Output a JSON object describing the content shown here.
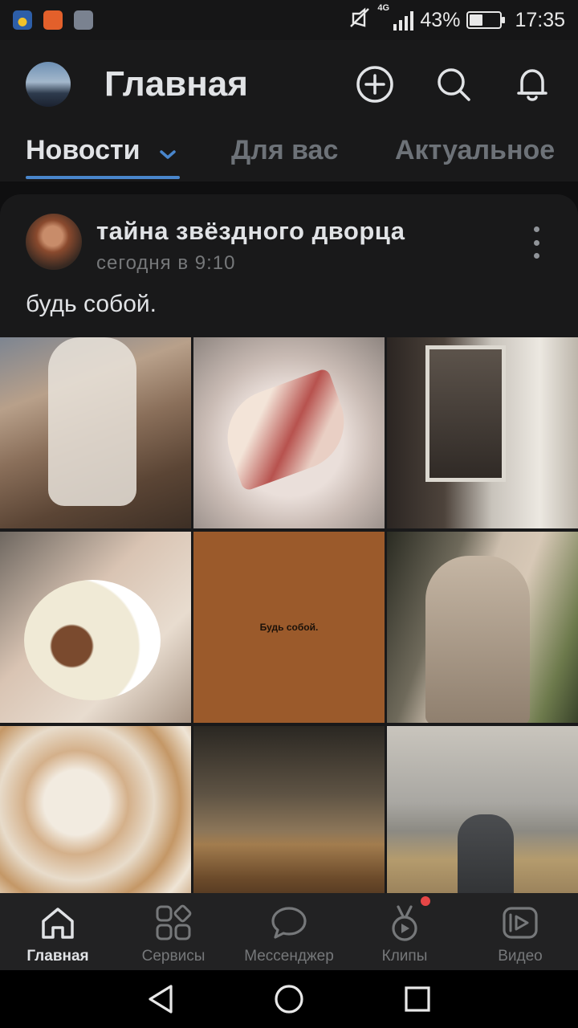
{
  "status_bar": {
    "network": "4G",
    "battery_text": "43%",
    "battery_level": 0.43,
    "time": "17:35",
    "app_icon_colors": [
      "#2d5ea8",
      "#e3602b",
      "#7a8290"
    ]
  },
  "header": {
    "title": "Главная",
    "icons": [
      "add-circle-icon",
      "search-icon",
      "bell-icon"
    ]
  },
  "tabs": [
    {
      "label": "Новости",
      "active": true,
      "has_dropdown": true
    },
    {
      "label": "Для вас",
      "active": false
    },
    {
      "label": "Актуальное",
      "active": false
    }
  ],
  "post": {
    "author": "тайна звёздного дворца",
    "time": "сегодня в 9:10",
    "text": "будь собой.",
    "image_caption": "Будь собой.",
    "photos": [
      "horse-rider",
      "sliced-peaches",
      "window-view",
      "ice-cream-cup",
      "text-card",
      "woman-sweater",
      "milk-foam",
      "storm-field",
      "beach-person"
    ]
  },
  "bottom_nav": [
    {
      "label": "Главная",
      "icon": "home-icon",
      "active": true
    },
    {
      "label": "Сервисы",
      "icon": "services-icon",
      "active": false
    },
    {
      "label": "Мессенджер",
      "icon": "messenger-icon",
      "active": false
    },
    {
      "label": "Клипы",
      "icon": "clips-icon",
      "active": false,
      "has_notification": true
    },
    {
      "label": "Видео",
      "icon": "video-icon",
      "active": false
    }
  ],
  "colors": {
    "accent": "#4986cc",
    "background": "#0f0f10",
    "card": "#19191a",
    "notification": "#e64646"
  }
}
